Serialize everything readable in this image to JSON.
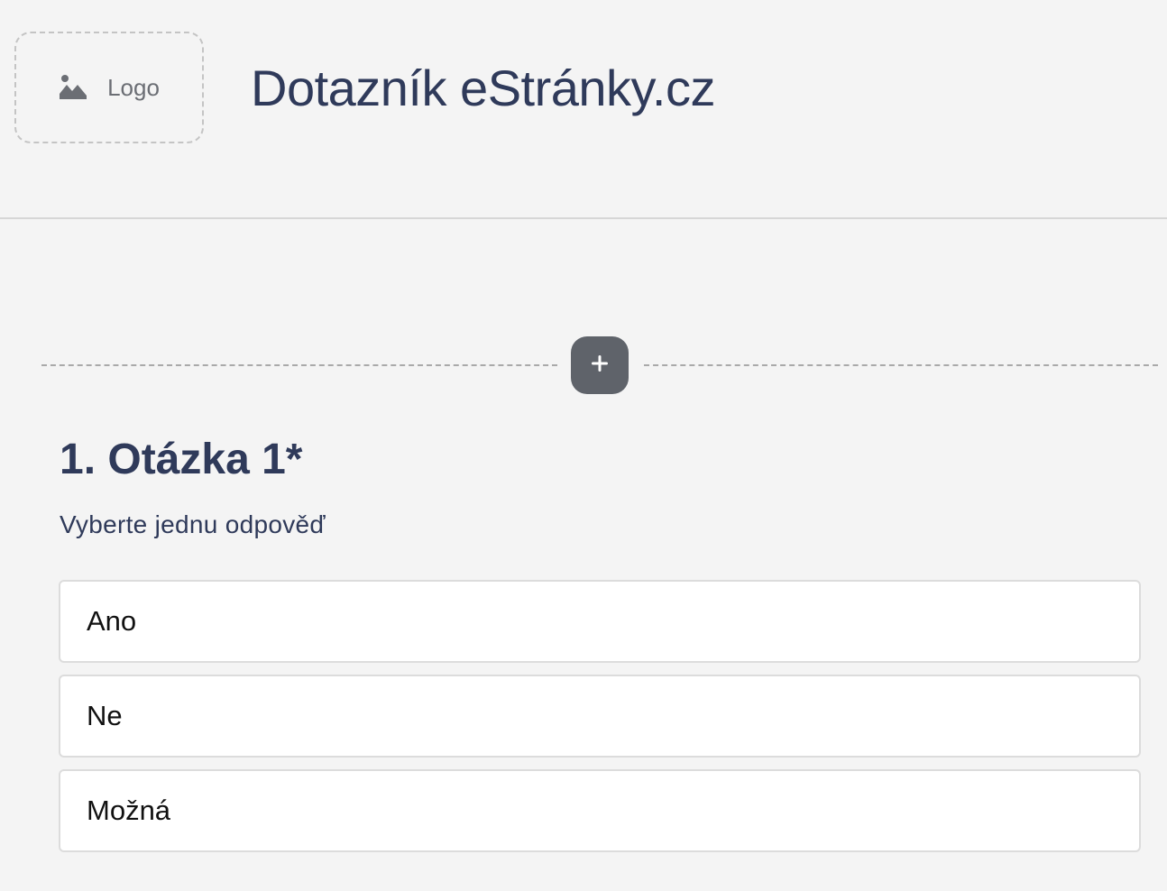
{
  "header": {
    "logo_label": "Logo",
    "logo_icon": "image-icon",
    "title": "Dotazník eStránky.cz"
  },
  "add_block": {
    "icon": "plus-icon"
  },
  "question": {
    "title": "1. Otázka 1*",
    "hint": "Vyberte jednu odpověď",
    "options": [
      {
        "label": "Ano"
      },
      {
        "label": "Ne"
      },
      {
        "label": "Možná"
      }
    ]
  },
  "colors": {
    "title_text": "#2f3a5a",
    "add_button_bg": "#5f636a",
    "background": "#f4f4f4",
    "option_bg": "#ffffff"
  }
}
